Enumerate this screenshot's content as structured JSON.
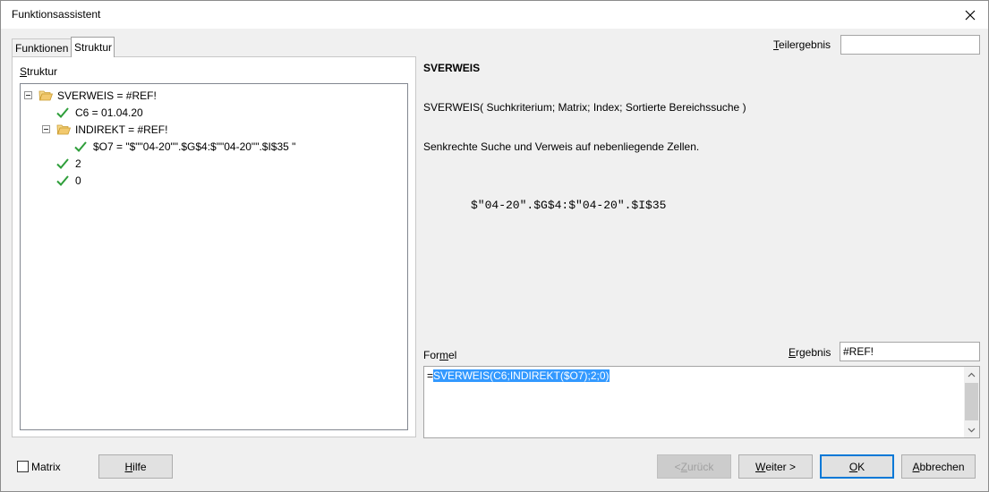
{
  "window": {
    "title": "Funktionsassistent",
    "close_glyph": "✕"
  },
  "tabs": [
    {
      "label": "Funktionen",
      "active": false
    },
    {
      "label": "Struktur",
      "active": true
    }
  ],
  "structure": {
    "label_first": "S",
    "label_rest": "truktur",
    "tree": [
      {
        "text": "SVERWEIS = #REF!",
        "kind": "function",
        "expanded": true
      },
      {
        "text": "C6 = 01.04.20",
        "kind": "valid"
      },
      {
        "text": "INDIREKT = #REF!",
        "kind": "function",
        "expanded": true
      },
      {
        "text": "$O7 = \"$\"\"04-20\"\".$G$4:$\"\"04-20\"\".$I$35 \"",
        "kind": "valid"
      },
      {
        "text": "2",
        "kind": "valid"
      },
      {
        "text": "0",
        "kind": "valid"
      }
    ]
  },
  "function_info": {
    "name": "SVERWEIS",
    "signature": "SVERWEIS( Suchkriterium; Matrix; Index; Sortierte Bereichssuche )",
    "description": "Senkrechte Suche und Verweis auf nebenliegende Zellen.",
    "parameter_value": "$\"04-20\".$G$4:$\"04-20\".$I$35"
  },
  "teilergebnis": {
    "label_first": "T",
    "label_rest": "eilergebnis",
    "value": ""
  },
  "formula": {
    "label_pre": "For",
    "label_u": "m",
    "label_post": "el",
    "prefix": "=",
    "selected": "SVERWEIS(C6;INDIREKT($O7);2;0)"
  },
  "ergebnis": {
    "label_first": "E",
    "label_rest": "rgebnis",
    "value": "#REF!"
  },
  "footer": {
    "matrix_label": "Matrix",
    "matrix_checked": false,
    "hilfe_first": "H",
    "hilfe_rest": "ilfe",
    "back_pre": "< ",
    "back_u": "Z",
    "back_post": "urück",
    "next_u": "W",
    "next_post": "eiter >",
    "ok_u": "O",
    "ok_post": "K",
    "cancel_u": "A",
    "cancel_post": "bbrechen"
  },
  "colors": {
    "selection": "#3399ff",
    "check": "#2e9e3a",
    "folder": "#f2c96e",
    "default_button_border": "#0078d7"
  }
}
